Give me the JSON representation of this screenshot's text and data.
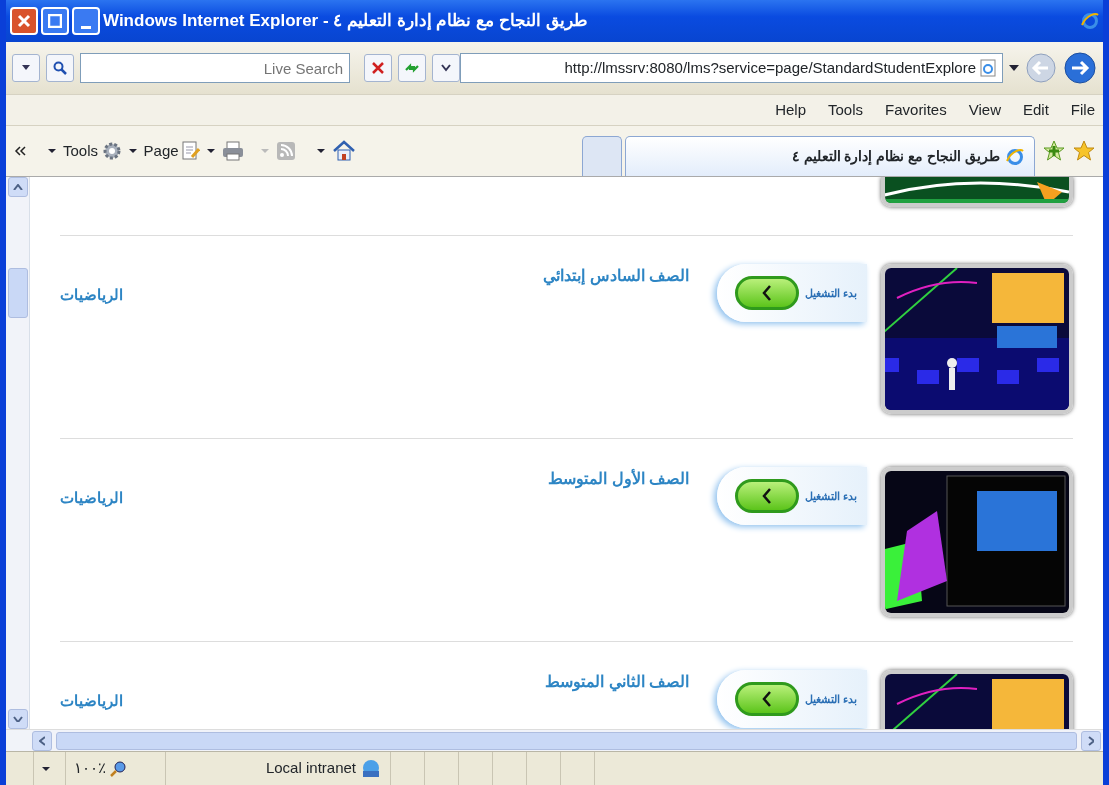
{
  "window": {
    "title": "طريق النجاح مع نظام إدارة التعليم ٤ - Windows Internet Explorer"
  },
  "address_bar": {
    "url": "http://lmssrv:8080/lms?service=page/StandardStudentExplore"
  },
  "search": {
    "placeholder": "Live Search"
  },
  "menu": [
    "File",
    "Edit",
    "View",
    "Favorites",
    "Tools",
    "Help"
  ],
  "command_bar": {
    "tools": "Tools",
    "page": "Page"
  },
  "tabs": [
    {
      "label": "طريق النجاح مع نظام إدارة التعليم ٤",
      "selected": true
    }
  ],
  "courses": [
    {
      "grade": "الصف السادس إبتدائي",
      "subject": "الرياضيات",
      "start": "بدء التشغيل"
    },
    {
      "grade": "الصف الأول المتوسط",
      "subject": "الرياضيات",
      "start": "بدء التشغيل"
    },
    {
      "grade": "الصف الثاني المتوسط",
      "subject": "الرياضيات",
      "start": "بدء التشغيل"
    }
  ],
  "status_bar": {
    "zoom": "١٠٠٪",
    "zone": "Local intranet"
  }
}
